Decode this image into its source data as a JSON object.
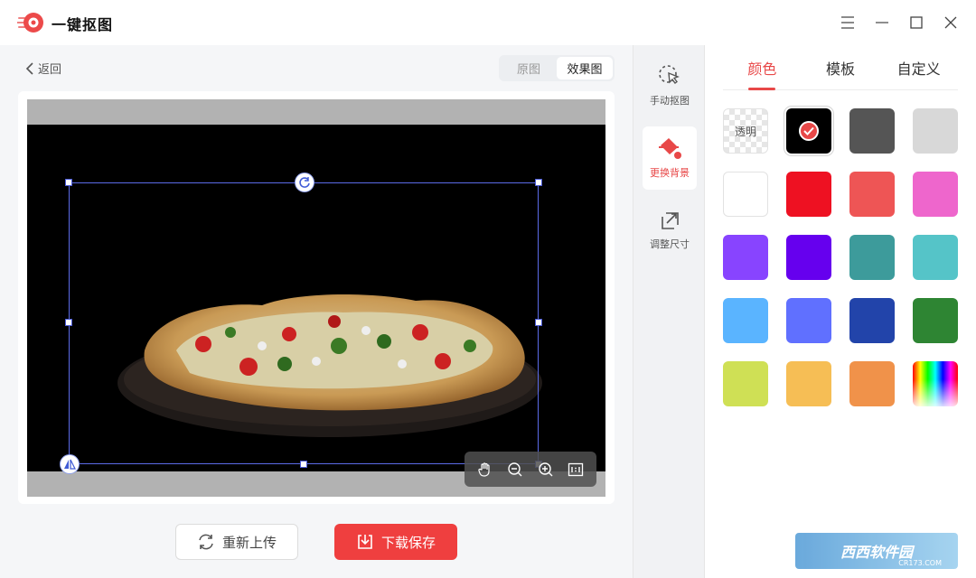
{
  "app": {
    "title": "一键抠图"
  },
  "window_controls": {
    "menu": "menu-icon",
    "minimize": "minimize-icon",
    "maximize": "maximize-icon",
    "close": "close-icon"
  },
  "main": {
    "back_label": "返回",
    "view_toggle": [
      {
        "label": "原图",
        "active": false
      },
      {
        "label": "效果图",
        "active": true
      }
    ],
    "zoom_tools": [
      "hand-icon",
      "zoom-out-icon",
      "zoom-in-icon",
      "actual-size-icon"
    ],
    "reupload_label": "重新上传",
    "save_label": "下载保存"
  },
  "tools": [
    {
      "label": "手动抠图",
      "icon": "manual-cutout-icon",
      "active": false
    },
    {
      "label": "更换背景",
      "icon": "paint-bucket-icon",
      "active": true
    },
    {
      "label": "调整尺寸",
      "icon": "resize-icon",
      "active": false
    }
  ],
  "panel": {
    "tabs": [
      {
        "label": "颜色",
        "active": true
      },
      {
        "label": "模板",
        "active": false
      },
      {
        "label": "自定义",
        "active": false
      }
    ],
    "transparent_label": "透明",
    "selected_color": "#000000",
    "colors": [
      "transparent",
      "#000000",
      "#555555",
      "#d8d8d8",
      "#ffffff",
      "#ee1122",
      "#ee5555",
      "#ee66cc",
      "#8844ff",
      "#6600ee",
      "#3d9b9b",
      "#55c4c8",
      "#5ab4ff",
      "#6070ff",
      "#2244aa",
      "#2e8533",
      "#cfe055",
      "#f6be55",
      "#f0924a",
      "rainbow"
    ]
  },
  "watermark": {
    "text": "西西软件园",
    "sub": "CR173.COM"
  }
}
